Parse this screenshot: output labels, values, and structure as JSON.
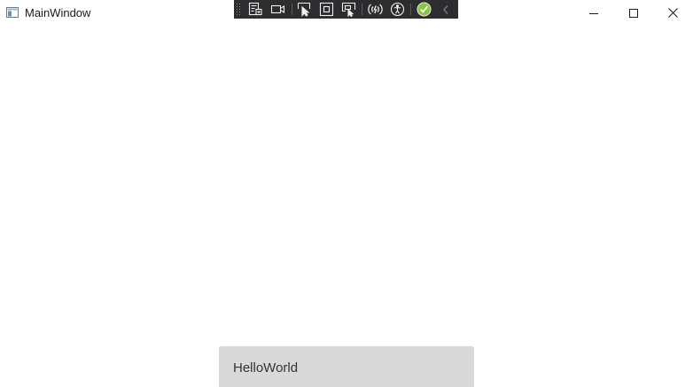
{
  "window": {
    "title": "MainWindow"
  },
  "caption_buttons": {
    "minimize_icon": "minimize-icon",
    "maximize_icon": "maximize-icon",
    "close_icon": "close-icon"
  },
  "devtools_toolbar": {
    "items": [
      "go-to-live-visual-tree-icon",
      "show-in-app-toolbar-video-icon",
      "select-element-icon",
      "display-layout-adorners-icon",
      "track-focused-element-icon",
      "hot-reload-icon",
      "accessibility-checker-icon",
      "binding-status-ok-icon",
      "collapse-toolbar-icon"
    ],
    "colors": {
      "background": "#2d2d30",
      "icon": "#f1f1f1",
      "ok": "#8bc34a"
    }
  },
  "content": {
    "button_label": "HelloWorld",
    "button_color": "#d9d9d9"
  }
}
